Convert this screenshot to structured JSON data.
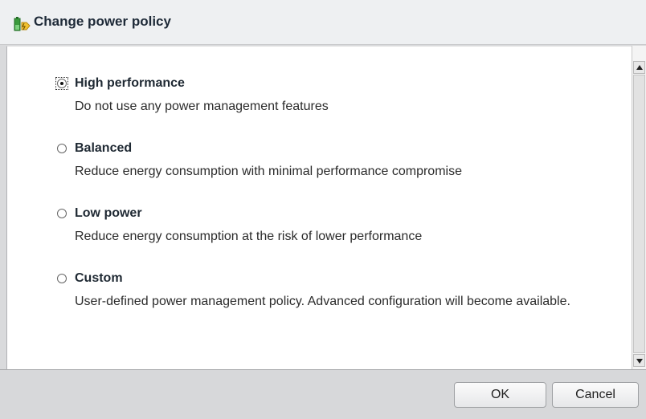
{
  "dialog": {
    "title": "Change power policy",
    "title_icon": "power-policy-icon"
  },
  "options": [
    {
      "label": "High performance",
      "description": "Do not use any power management features",
      "selected": true
    },
    {
      "label": "Balanced",
      "description": "Reduce energy consumption with minimal performance compromise",
      "selected": false
    },
    {
      "label": "Low power",
      "description": "Reduce energy consumption at the risk of lower performance",
      "selected": false
    },
    {
      "label": "Custom",
      "description": "User-defined power management policy. Advanced configuration will become available.",
      "selected": false
    }
  ],
  "footer": {
    "ok_label": "OK",
    "cancel_label": "Cancel"
  },
  "colors": {
    "title_bg": "#eef0f2",
    "footer_bg": "#d7d8da",
    "content_bg": "#ffffff"
  }
}
